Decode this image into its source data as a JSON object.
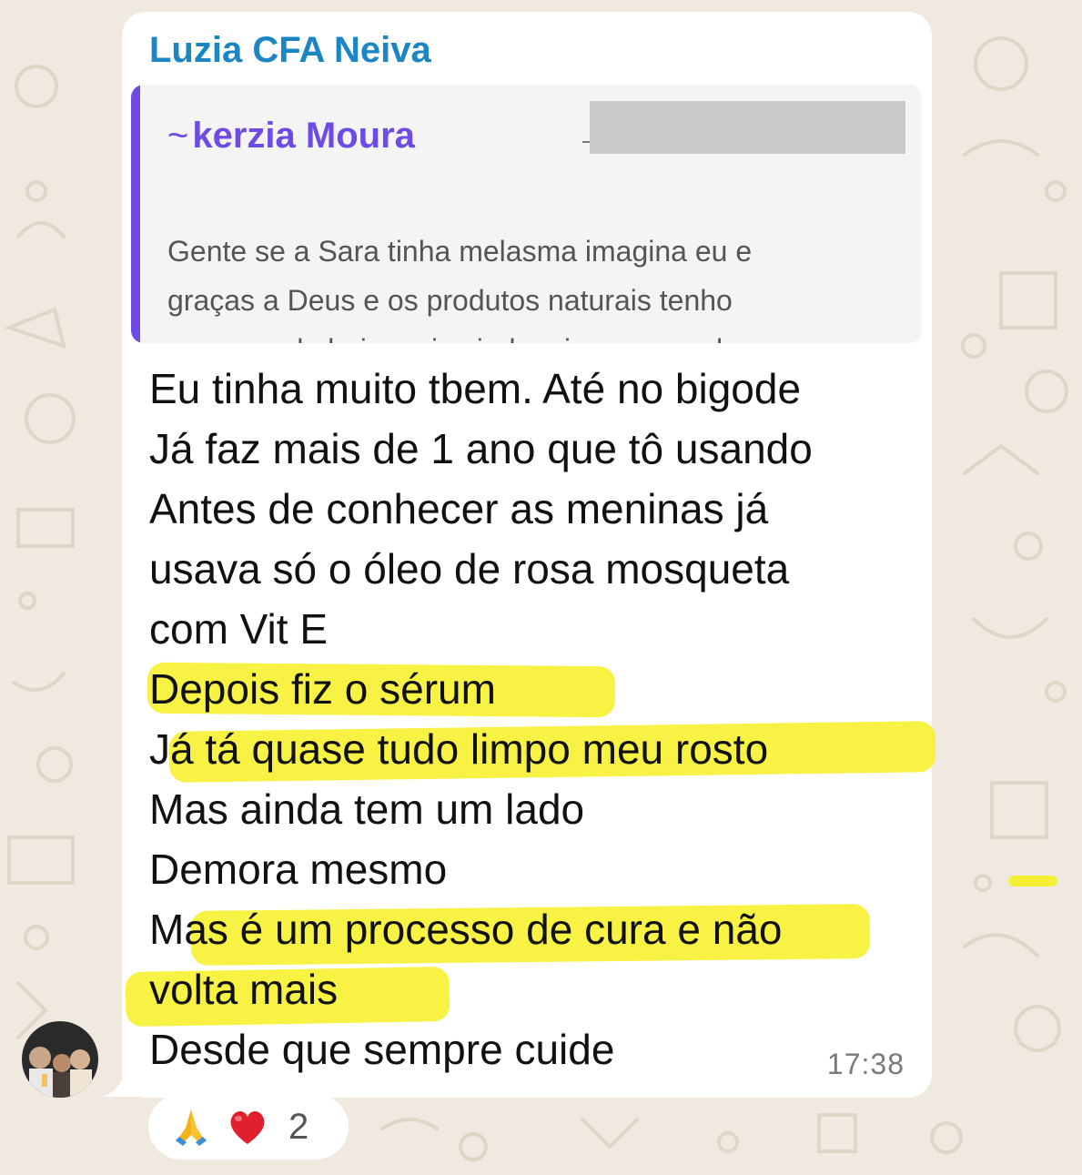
{
  "chat": {
    "sender_name": "Luzia CFA Neiva",
    "quoted_message": {
      "author": "kerzia Moura",
      "author_prefix": "~",
      "text_lines": [
        "Gente se a Sara tinha melasma imagina eu e",
        "graças a Deus e os produtos naturais tenho",
        "quase nada hoje mais ainda mim encomod..."
      ]
    },
    "message_lines": [
      "Eu tinha muito tbem. Até no bigode",
      "Já faz mais de 1 ano que tô usando",
      "Antes de conhecer as meninas já",
      "usava só o óleo de rosa mosqueta",
      "com Vit E",
      "Depois fiz o sérum",
      "Já tá quase tudo limpo meu rosto",
      "Mas ainda tem um lado",
      "Demora mesmo",
      "Mas é um processo de cura e não",
      "volta mais",
      "Desde que sempre cuide"
    ],
    "timestamp": "17:38",
    "reactions": {
      "icons": [
        "folded-hands-icon",
        "red-heart-icon"
      ],
      "count": "2"
    },
    "colors": {
      "sender": "#1b86c3",
      "quote_accent": "#6e4be6",
      "highlight": "#f6f023",
      "wallpaper": "#efe9df"
    }
  }
}
